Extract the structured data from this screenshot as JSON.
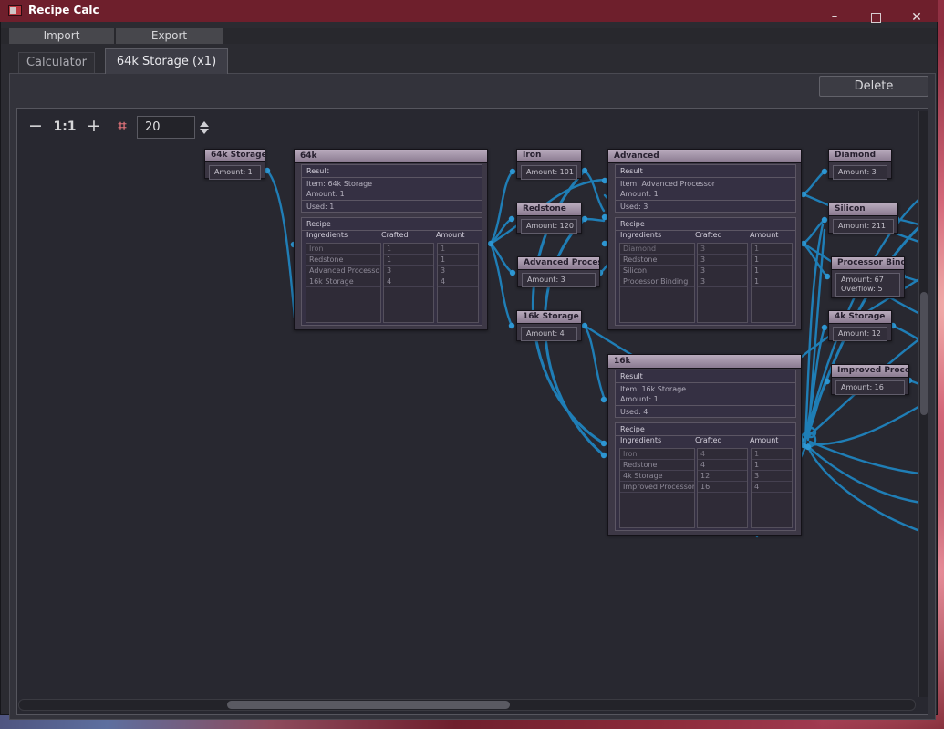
{
  "window": {
    "title": "Recipe Calc"
  },
  "icons": {
    "minimize": "–",
    "close": "✕",
    "snap_grid": "⌗",
    "spin_up": "up-arrow",
    "spin_down": "down-arrow"
  },
  "menubar": {
    "import": "Import",
    "export": "Export"
  },
  "tabs": {
    "calculator": "Calculator",
    "storage": "64k Storage (x1)"
  },
  "pane": {
    "delete": "Delete"
  },
  "graph_toolbar": {
    "zoom_out": "−",
    "zoom_reset": "1:1",
    "zoom_in": "+",
    "grid_value": "20"
  },
  "labels": {
    "result": "Result",
    "recipe": "Recipe",
    "headers": [
      "Ingredients",
      "Crafted",
      "Amount"
    ]
  },
  "colors": {
    "titlebar": "#6e1f2c",
    "wire": "#1f86c2",
    "node_title": "#a998ae",
    "snap_icon": "#e2737a"
  },
  "items": {
    "storage64k": {
      "title": "64k Storage",
      "amount": "Amount: 1"
    },
    "iron": {
      "title": "Iron",
      "amount": "Amount: 101"
    },
    "redstone": {
      "title": "Redstone",
      "amount": "Amount: 120"
    },
    "advproc": {
      "title": "Advanced Processor",
      "amount": "Amount: 3"
    },
    "storage16k": {
      "title": "16k Storage",
      "amount": "Amount: 4"
    },
    "diamond": {
      "title": "Diamond",
      "amount": "Amount: 3"
    },
    "silicon": {
      "title": "Silicon",
      "amount": "Amount: 211"
    },
    "procbinding": {
      "title": "Processor Binding",
      "amount": "Amount: 67",
      "overflow": "Overflow: 5"
    },
    "storage4k": {
      "title": "4k Storage",
      "amount": "Amount: 12"
    },
    "improcessor": {
      "title": "Improved Processor",
      "amount": "Amount: 16"
    }
  },
  "recipes": {
    "r64k": {
      "title": "64k",
      "item": "Item: 64k Storage",
      "amount": "Amount: 1",
      "used": "Used: 1",
      "rows": [
        [
          "Iron",
          "1",
          "1"
        ],
        [
          "Redstone",
          "1",
          "1"
        ],
        [
          "Advanced Processor",
          "3",
          "3"
        ],
        [
          "16k Storage",
          "4",
          "4"
        ]
      ]
    },
    "radvanced": {
      "title": "Advanced",
      "item": "Item: Advanced Processor",
      "amount": "Amount: 1",
      "used": "Used: 3",
      "rows": [
        [
          "Diamond",
          "3",
          "1"
        ],
        [
          "Redstone",
          "3",
          "1"
        ],
        [
          "Silicon",
          "3",
          "1"
        ],
        [
          "Processor Binding",
          "3",
          "1"
        ]
      ]
    },
    "r16k": {
      "title": "16k",
      "item": "Item: 16k Storage",
      "amount": "Amount: 1",
      "used": "Used: 4",
      "rows": [
        [
          "Iron",
          "4",
          "1"
        ],
        [
          "Redstone",
          "4",
          "1"
        ],
        [
          "4k Storage",
          "12",
          "3"
        ],
        [
          "Improved Processor",
          "16",
          "4"
        ]
      ]
    }
  }
}
